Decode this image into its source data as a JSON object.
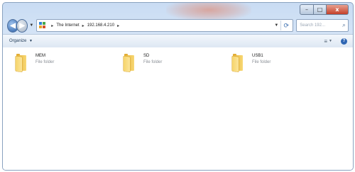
{
  "window": {
    "caption": {
      "minimize": "–",
      "maximize": "□",
      "close": "x"
    }
  },
  "navigation": {
    "back_icon": "back-arrow-icon",
    "forward_icon": "forward-arrow-icon",
    "address": {
      "crumbs": [
        "The Internet",
        "192.168.4.210"
      ],
      "separator": "▸"
    },
    "search_placeholder": "Search 192..."
  },
  "command_bar": {
    "organize_label": "Organize",
    "organize_arrow": "▼",
    "views_glyph": "≡",
    "views_arrow": "▼",
    "help_glyph": "?"
  },
  "folders": [
    {
      "name": "MEM",
      "type": "File folder"
    },
    {
      "name": "SD",
      "type": "File folder"
    },
    {
      "name": "USB1",
      "type": "File folder"
    }
  ],
  "colors": {
    "accent_blue": "#2f62a8",
    "close_red": "#c4402a",
    "folder_yellow": "#f6d46a"
  }
}
